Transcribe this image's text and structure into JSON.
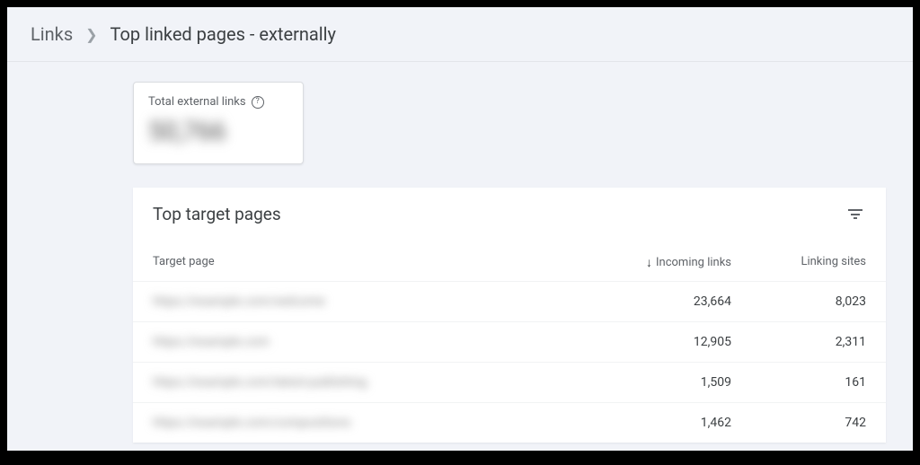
{
  "breadcrumb": {
    "root": "Links",
    "current": "Top linked pages - externally"
  },
  "stat": {
    "label": "Total external links",
    "value": "50,766"
  },
  "table": {
    "title": "Top target pages",
    "headers": {
      "target": "Target page",
      "incoming": "Incoming links",
      "linking": "Linking sites"
    },
    "rows": [
      {
        "target": "https://example.com/welcome",
        "incoming": "23,664",
        "linking": "8,023"
      },
      {
        "target": "https://example.com",
        "incoming": "12,905",
        "linking": "2,311"
      },
      {
        "target": "https://example.com/latest-publishing",
        "incoming": "1,509",
        "linking": "161"
      },
      {
        "target": "https://example.com/compositions",
        "incoming": "1,462",
        "linking": "742"
      }
    ]
  }
}
